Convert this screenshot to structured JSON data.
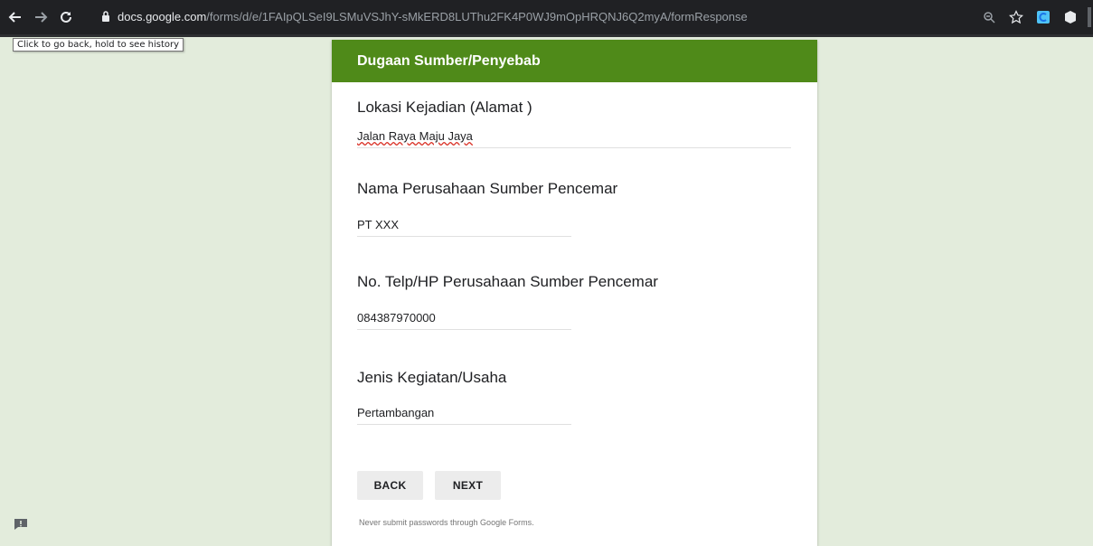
{
  "browser": {
    "url_host": "docs.google.com",
    "url_path": "/forms/d/e/1FAIpQLSeI9LSMuVSJhY-sMkERD8LUThu2FK4P0WJ9mOpHRQNJ6Q2myA/formResponse",
    "tooltip": "Click to go back, hold to see history",
    "icons": [
      "back-arrow-icon",
      "forward-arrow-icon",
      "reload-icon",
      "lock-icon",
      "zoom-icon",
      "star-icon",
      "extension-icon",
      "extension-icon"
    ]
  },
  "form": {
    "section_title": "Dugaan Sumber/Penyebab",
    "header_color": "#4f8a19",
    "questions": [
      {
        "label": "Lokasi Kejadian (Alamat )",
        "value": "Jalan Raya Maju Jaya"
      },
      {
        "label": "Nama Perusahaan Sumber Pencemar",
        "value": "PT XXX"
      },
      {
        "label": "No. Telp/HP Perusahaan Sumber Pencemar",
        "value": "084387970000"
      },
      {
        "label": "Jenis Kegiatan/Usaha",
        "value": "Pertambangan"
      }
    ],
    "back_label": "BACK",
    "next_label": "NEXT",
    "disclaimer": "Never submit passwords through Google Forms."
  }
}
